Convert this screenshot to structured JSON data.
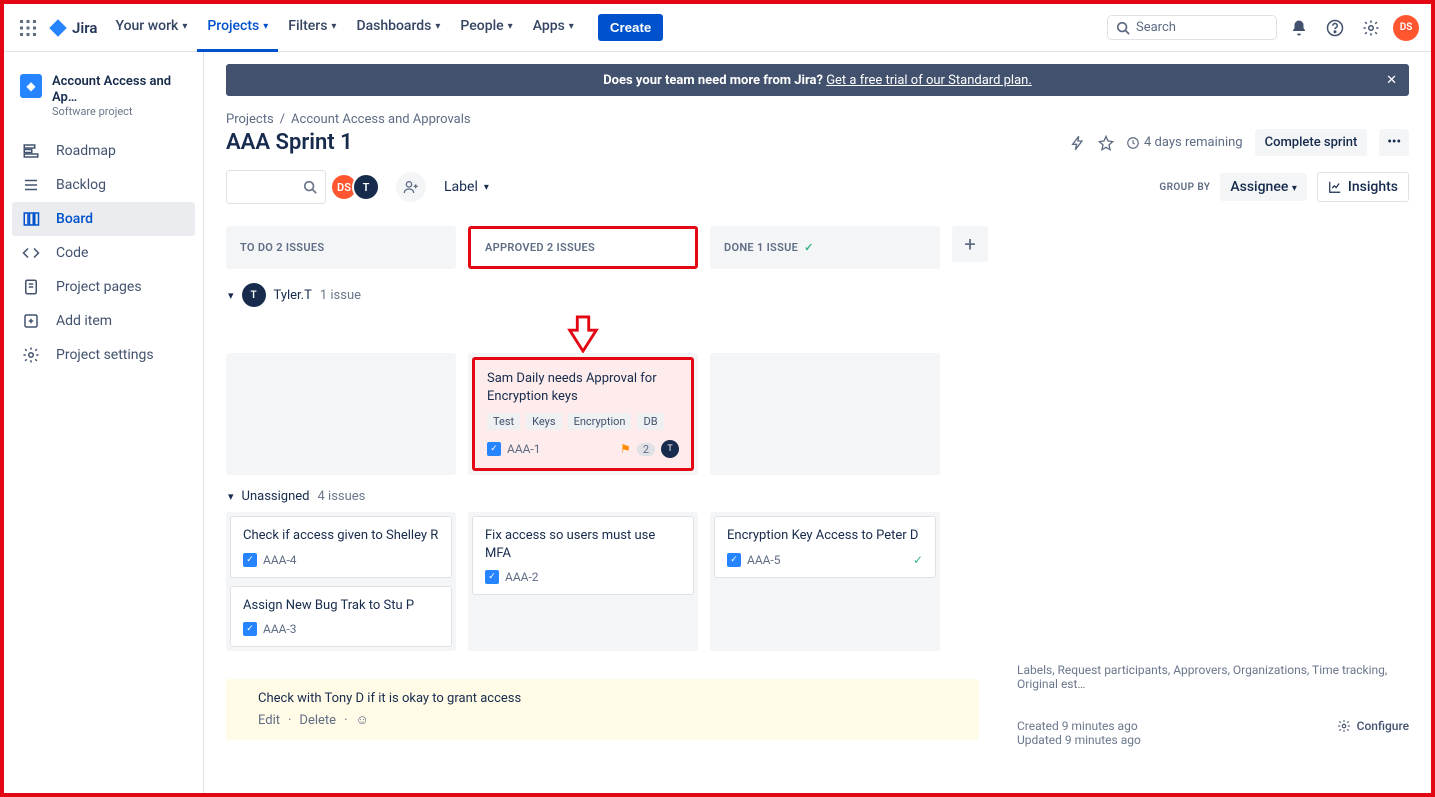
{
  "topnav": {
    "product": "Jira",
    "items": [
      "Your work",
      "Projects",
      "Filters",
      "Dashboards",
      "People",
      "Apps"
    ],
    "active_index": 1,
    "create": "Create",
    "search_placeholder": "Search",
    "user_initials": "DS"
  },
  "banner": {
    "text": "Does your team need more from Jira? ",
    "link": "Get a free trial of our Standard plan."
  },
  "project": {
    "name": "Account Access and Ap…",
    "type": "Software project"
  },
  "sidebar": {
    "items": [
      {
        "icon": "roadmap",
        "label": "Roadmap"
      },
      {
        "icon": "backlog",
        "label": "Backlog"
      },
      {
        "icon": "board",
        "label": "Board"
      },
      {
        "icon": "code",
        "label": "Code"
      },
      {
        "icon": "pages",
        "label": "Project pages"
      },
      {
        "icon": "add",
        "label": "Add item"
      },
      {
        "icon": "settings",
        "label": "Project settings"
      }
    ],
    "active_index": 2
  },
  "breadcrumbs": [
    "Projects",
    "Account Access and Approvals"
  ],
  "page": {
    "title": "AAA Sprint 1",
    "remaining": "4 days remaining",
    "complete": "Complete sprint",
    "label_filter": "Label",
    "groupby_label": "GROUP BY",
    "groupby_value": "Assignee",
    "insights": "Insights"
  },
  "avatars": [
    {
      "text": "DS",
      "cls": "ds"
    },
    {
      "text": "T",
      "cls": "t"
    }
  ],
  "columns": [
    {
      "title": "TO DO",
      "count": "2 ISSUES",
      "highlight": false,
      "done": false
    },
    {
      "title": "APPROVED",
      "count": "2 ISSUES",
      "highlight": true,
      "done": false
    },
    {
      "title": "DONE",
      "count": "1 ISSUE",
      "highlight": false,
      "done": true
    }
  ],
  "swimlanes": [
    {
      "name": "Tyler.T",
      "count": "1 issue",
      "avatar": "T",
      "cols": [
        [],
        [
          {
            "title": "Sam Daily needs Approval for Encryption keys",
            "tags": [
              "Test",
              "Keys",
              "Encryption",
              "DB"
            ],
            "key": "AAA-1",
            "flag": true,
            "badge": "2",
            "assignee": "T",
            "highlight": true
          }
        ],
        []
      ]
    },
    {
      "name": "Unassigned",
      "count": "4 issues",
      "avatar": "",
      "cols": [
        [
          {
            "title": "Check if access given to Shelley R",
            "key": "AAA-4"
          },
          {
            "title": "Assign New Bug Trak to Stu P",
            "key": "AAA-3"
          }
        ],
        [
          {
            "title": "Fix access so users must use MFA",
            "key": "AAA-2"
          }
        ],
        [
          {
            "title": "Encryption Key Access to Peter D",
            "key": "AAA-5",
            "done": true
          }
        ]
      ]
    }
  ],
  "activity": {
    "text": "Check with Tony D if it is okay to grant access",
    "edit": "Edit",
    "delete": "Delete"
  },
  "side_meta": {
    "line": "Labels, Request participants, Approvers, Organizations, Time tracking, Original est…",
    "created": "Created 9 minutes ago",
    "updated": "Updated 9 minutes ago",
    "configure": "Configure"
  }
}
